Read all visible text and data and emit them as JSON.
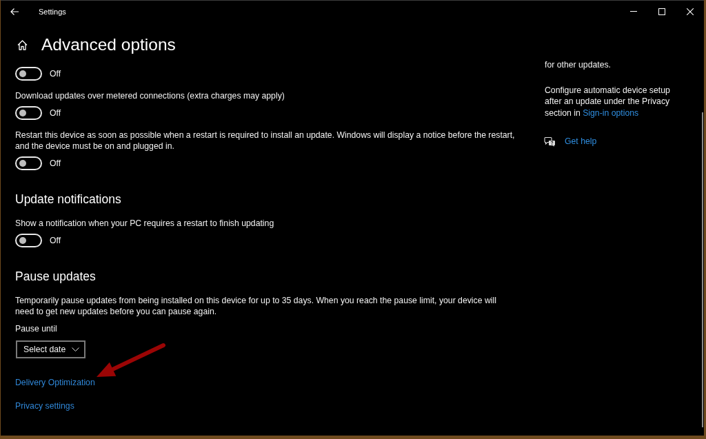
{
  "window": {
    "title": "Settings"
  },
  "page": {
    "title": "Advanced options"
  },
  "sections": [
    {
      "items": [
        {
          "kind": "toggle",
          "on": false,
          "state_label": "Off"
        },
        {
          "kind": "toggle",
          "label": "Download updates over metered connections (extra charges may apply)",
          "on": false,
          "state_label": "Off"
        },
        {
          "kind": "toggle",
          "label": "Restart this device as soon as possible when a restart is required to install an update. Windows will display a notice before the restart, and the device must be on and plugged in.",
          "on": false,
          "state_label": "Off"
        }
      ]
    },
    {
      "heading": "Update notifications",
      "items": [
        {
          "kind": "toggle",
          "label": "Show a notification when your PC requires a restart to finish updating",
          "on": false,
          "state_label": "Off"
        }
      ]
    },
    {
      "heading": "Pause updates",
      "items": [
        {
          "kind": "text",
          "text": "Temporarily pause updates from being installed on this device for up to 35 days. When you reach the pause limit, your device will need to get new updates before you can pause again."
        },
        {
          "kind": "dropdown",
          "label": "Pause until",
          "value": "Select date"
        }
      ]
    }
  ],
  "links": [
    {
      "label": "Delivery Optimization",
      "annotated": true
    },
    {
      "label": "Privacy settings",
      "annotated": false
    }
  ],
  "aside": {
    "paragraphs": [
      {
        "text": "for other updates."
      },
      {
        "text": "Configure automatic device setup after an update under the Privacy section in ",
        "link": "Sign-in options"
      }
    ],
    "help_link": "Get help"
  }
}
